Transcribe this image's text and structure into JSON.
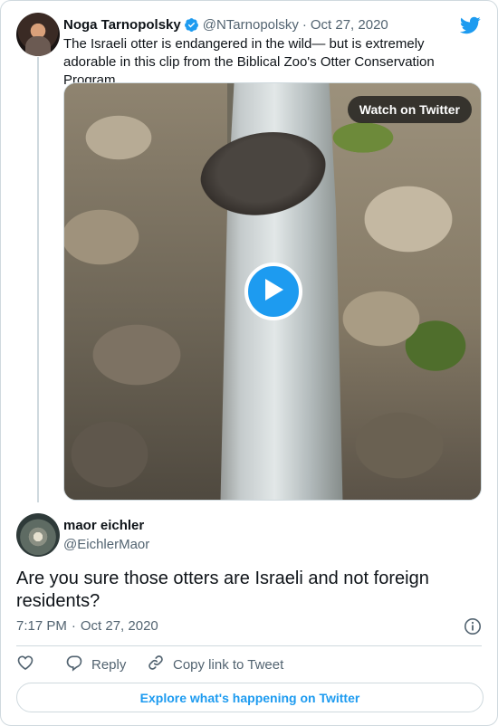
{
  "quoted_tweet": {
    "author_name": "Noga Tarnopolsky",
    "handle": "@NTarnopolsky",
    "date": "Oct 27, 2020",
    "text": "The Israeli otter is endangered in the wild— but is extremely adorable in this clip from the Biblical Zoo's Otter Conservation Program",
    "video": {
      "watch_label": "Watch on Twitter"
    }
  },
  "reply_tweet": {
    "author_name": "maor eichler",
    "handle": "@EichlerMaor",
    "text": "Are you sure those otters are Israeli and not foreign residents?",
    "time": "7:17 PM",
    "separator": "·",
    "date": "Oct 27, 2020"
  },
  "actions": {
    "reply_label": "Reply",
    "copy_link_label": "Copy link to Tweet"
  },
  "explore_label": "Explore what's happening on Twitter",
  "icons": {
    "verified": "verified-badge-icon",
    "twitter": "twitter-bird-icon",
    "play": "play-icon",
    "info": "info-icon",
    "like": "heart-icon",
    "reply": "reply-bubble-icon",
    "link": "link-icon"
  },
  "colors": {
    "accent": "#1d9bf0",
    "text": "#0f1419",
    "secondary": "#536471",
    "border": "#cfd9de"
  }
}
